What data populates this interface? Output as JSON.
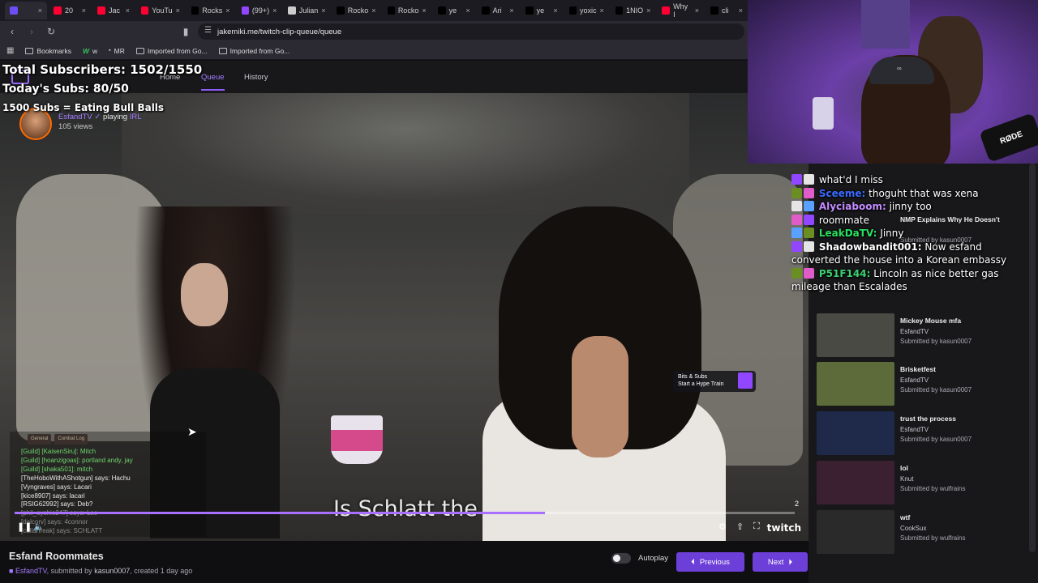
{
  "browser": {
    "tabs": [
      {
        "label": "",
        "active": true,
        "color": "#6e4cf6"
      },
      {
        "label": "20",
        "color": "#ff0033"
      },
      {
        "label": "Jac",
        "color": "#ff0033"
      },
      {
        "label": "YouTu",
        "color": "#ff0033"
      },
      {
        "label": "Rocks",
        "color": "#000000"
      },
      {
        "label": "(99+)",
        "color": "#9146ff"
      },
      {
        "label": "Julian",
        "color": "#cccccc"
      },
      {
        "label": "Rocko",
        "color": "#000000"
      },
      {
        "label": "Rocko",
        "color": "#000000"
      },
      {
        "label": "ye",
        "color": "#000000"
      },
      {
        "label": "Ari",
        "color": "#000000"
      },
      {
        "label": "ye",
        "color": "#000000"
      },
      {
        "label": "yoxic",
        "color": "#000000"
      },
      {
        "label": "1NIO",
        "color": "#000000"
      },
      {
        "label": "Why I",
        "color": "#ff0033"
      },
      {
        "label": "cli",
        "color": "#000000"
      }
    ],
    "url": "jakemiki.me/twitch-clip-queue/queue",
    "bookmarks": [
      {
        "label": "Bookmarks",
        "icon": "folder-icon"
      },
      {
        "label": "w",
        "icon": "w-icon"
      },
      {
        "label": "MR",
        "icon": "mr-icon"
      },
      {
        "label": "Imported from Go...",
        "icon": "folder-icon"
      },
      {
        "label": "Imported from Go...",
        "icon": "folder-icon"
      }
    ]
  },
  "site": {
    "nav": [
      {
        "label": "Home",
        "active": false
      },
      {
        "label": "Queue",
        "active": true
      },
      {
        "label": "History",
        "active": false
      }
    ]
  },
  "overlay": {
    "total_subs": "Total Subscribers: 1502/1550",
    "today_subs": "Today's Subs: 80/50",
    "goal": "1500 Subs = Eating Bull Balls"
  },
  "clip": {
    "channel": "EsfandTV",
    "playing_label": "playing",
    "game": "IRL",
    "views": "105 views",
    "subtitle": "Is Schlatt the",
    "progress": 0.68,
    "count": "2",
    "hype_line1": "Bits & Subs",
    "hype_line2": "Start a Hype Train",
    "title": "Esfand Roommates",
    "submitted_prefix": ", submitted by ",
    "submitter": "kasun0007",
    "created": ", created 1 day ago"
  },
  "game_chat": {
    "tabs": [
      "General",
      "Combat Log"
    ],
    "lines": [
      {
        "text": "[Guild] [KaisenSiru]: Mitch",
        "kind": "guild"
      },
      {
        "text": "[Guild] [hoanzigoas]: portland andy, jay",
        "kind": "guild"
      },
      {
        "text": "[Guild] [shaka501]: mitch",
        "kind": "guild"
      },
      {
        "text": "[TheHoboWithAShotgun] says: Hachu",
        "kind": "say"
      },
      {
        "text": "[Vyngraves] says: Lacari",
        "kind": "say"
      },
      {
        "text": "[kice8907] says: lacari",
        "kind": "say"
      },
      {
        "text": "[RSIG62992] says: Deb?",
        "kind": "say"
      },
      {
        "text": "[phil_ayshio247] says: Lac",
        "kind": "dim"
      },
      {
        "text": "[dalcorv] says: 4connor",
        "kind": "dim"
      },
      {
        "text": "[callarfreak] says: SCHLATT",
        "kind": "dim"
      }
    ]
  },
  "player_controls": {
    "pause_icon": "pause-icon",
    "volume_icon": "volume-icon",
    "settings_icon": "gear-icon",
    "share_icon": "share-icon",
    "fullscreen_icon": "fullscreen-icon",
    "brand": "twitch"
  },
  "controls": {
    "autoplay_label": "Autoplay",
    "autoplay_on": false,
    "previous_label": "Previous",
    "next_label": "Next",
    "accent": "#6d3fd9"
  },
  "stream_chat": [
    {
      "user": "",
      "msg": "what'd I miss",
      "color": "#ff4040"
    },
    {
      "user": "Sceeme:",
      "msg": "thoguht that was xena",
      "color": "#3a6bff"
    },
    {
      "user": "Alyciaboom:",
      "msg": "jinny too",
      "color": "#c28cff"
    },
    {
      "user": "",
      "msg": "roommate",
      "color": "#ffffff"
    },
    {
      "user": "LeakDaTV:",
      "msg": "Jinny",
      "color": "#28e060"
    },
    {
      "user": "Shadowbandit001:",
      "msg": "Now esfand converted the house into a Korean embassy",
      "color": "#ffffff"
    },
    {
      "user": "P51F144:",
      "msg": "Lincoln as nice better gas mileage than Escalades",
      "color": "#3cd070"
    }
  ],
  "queue": [
    {
      "title": "NMP Explains Why He Doesn't",
      "channel": "",
      "submitter": "Submitted by kasun0007",
      "thumb": "#3a3530"
    },
    {
      "title": "Mickey Mouse mfa",
      "channel": "EsfandTV",
      "submitter": "Submitted by kasun0007",
      "thumb": "#4a4a45"
    },
    {
      "title": "Brisketfest",
      "channel": "EsfandTV",
      "submitter": "Submitted by kasun0007",
      "thumb": "#5d6a3a"
    },
    {
      "title": "trust the process",
      "channel": "EsfandTV",
      "submitter": "Submitted by kasun0007",
      "thumb": "#1f2a4a"
    },
    {
      "title": "lol",
      "channel": "Knut",
      "submitter": "Submitted by wulfrains",
      "thumb": "#3a2030"
    },
    {
      "title": "wtf",
      "channel": "CookSux",
      "submitter": "Submitted by wulfrains",
      "thumb": "#2a2a2a"
    }
  ],
  "webcam": {
    "mic_brand": "RØDE"
  }
}
